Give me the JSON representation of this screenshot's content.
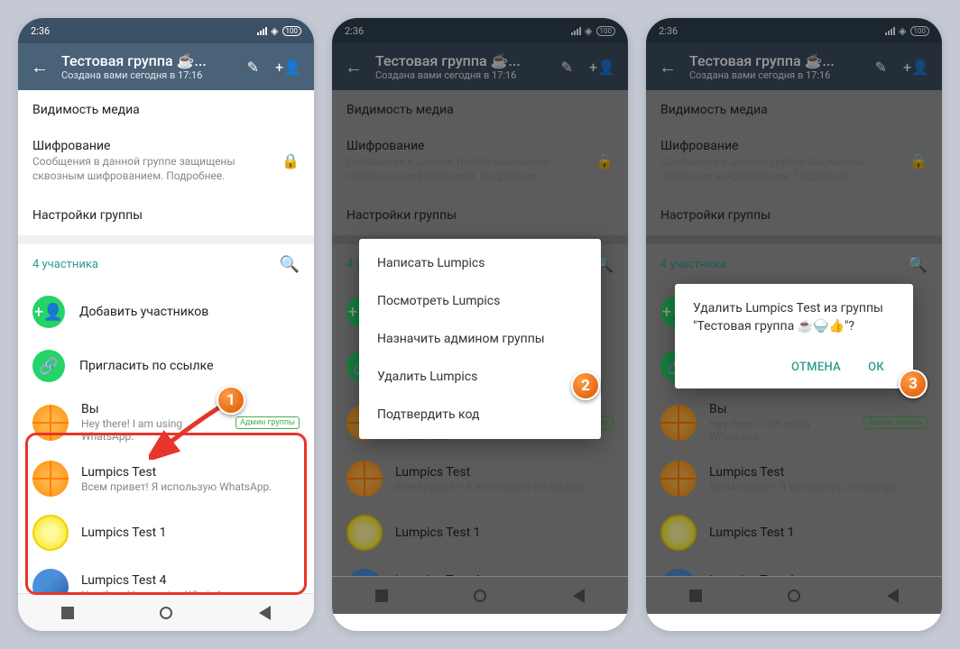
{
  "statusbar": {
    "time": "2:36",
    "battery": "100"
  },
  "appbar": {
    "title": "Тестовая группа ☕...",
    "subtitle": "Создана вами сегодня в 17:16"
  },
  "rows": {
    "media": "Видимость медиа",
    "enc_title": "Шифрование",
    "enc_sub": "Сообщения в данной группе защищены сквозным шифрованием. Подробнее.",
    "settings": "Настройки группы"
  },
  "participants": {
    "count": "4 участника"
  },
  "actions": {
    "add": "Добавить участников",
    "invite": "Пригласить по ссылке"
  },
  "members": {
    "you": {
      "name": "Вы",
      "status": "Hey there! I am using WhatsApp.",
      "badge": "Админ группы"
    },
    "m1": {
      "name": "Lumpics Test",
      "status": "Всем привет! Я использую WhatsApp."
    },
    "m2": {
      "name": "Lumpics Test 1",
      "status": ""
    },
    "m3": {
      "name": "Lumpics Test 4",
      "status": "Hey there! I am using WhatsApp."
    }
  },
  "menu": {
    "write": "Написать Lumpics",
    "view": "Посмотреть Lumpics",
    "admin": "Назначить админом группы",
    "remove": "Удалить Lumpics",
    "code": "Подтвердить код"
  },
  "dialog": {
    "text": "Удалить Lumpics Test из группы \"Тестовая группа ☕🍚👍\"?",
    "cancel": "ОТМЕНА",
    "ok": "ОК"
  },
  "steps": {
    "s1": "1",
    "s2": "2",
    "s3": "3"
  }
}
